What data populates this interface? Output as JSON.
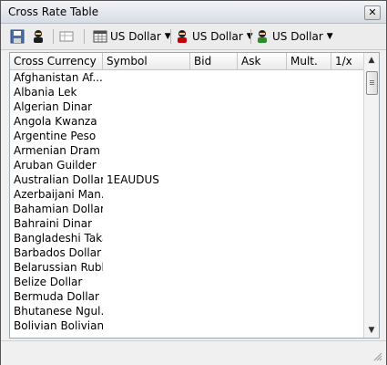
{
  "window": {
    "title": "Cross Rate Table",
    "close_glyph": "✕"
  },
  "toolbar": {
    "icons": [
      "save-icon",
      "user-icon",
      "table-options-icon"
    ],
    "dropdowns": [
      {
        "label": "US Dollar",
        "icon": "calendar-icon"
      },
      {
        "label": "US Dollar",
        "icon": "user-red-icon"
      },
      {
        "label": "US Dollar",
        "icon": "user-green-icon"
      }
    ]
  },
  "table": {
    "columns": [
      "Cross Currency",
      "Symbol",
      "Bid",
      "Ask",
      "Mult.",
      "1/x"
    ],
    "rows": [
      {
        "currency": "Afghanistan Af...",
        "symbol": ""
      },
      {
        "currency": "Albania Lek",
        "symbol": ""
      },
      {
        "currency": "Algerian Dinar",
        "symbol": ""
      },
      {
        "currency": "Angola Kwanza",
        "symbol": ""
      },
      {
        "currency": "Argentine Peso",
        "symbol": ""
      },
      {
        "currency": "Armenian Dram",
        "symbol": ""
      },
      {
        "currency": "Aruban Guilder",
        "symbol": ""
      },
      {
        "currency": "Australian Dollar",
        "symbol": "1EAUDUS"
      },
      {
        "currency": "Azerbaijani Man...",
        "symbol": ""
      },
      {
        "currency": "Bahamian Dollar",
        "symbol": ""
      },
      {
        "currency": "Bahraini Dinar",
        "symbol": ""
      },
      {
        "currency": "Bangladeshi Taka",
        "symbol": ""
      },
      {
        "currency": "Barbados Dollar",
        "symbol": ""
      },
      {
        "currency": "Belarussian Ruble",
        "symbol": ""
      },
      {
        "currency": "Belize Dollar",
        "symbol": ""
      },
      {
        "currency": "Bermuda Dollar",
        "symbol": ""
      },
      {
        "currency": "Bhutanese Ngul...",
        "symbol": ""
      },
      {
        "currency": "Bolivian Boliviano",
        "symbol": ""
      }
    ]
  },
  "scrollbar": {
    "up": "▲",
    "down": "▼"
  },
  "colors": {
    "border": "#9ea6b0",
    "accent_red": "#c00000",
    "accent_green": "#2e8b2e"
  }
}
